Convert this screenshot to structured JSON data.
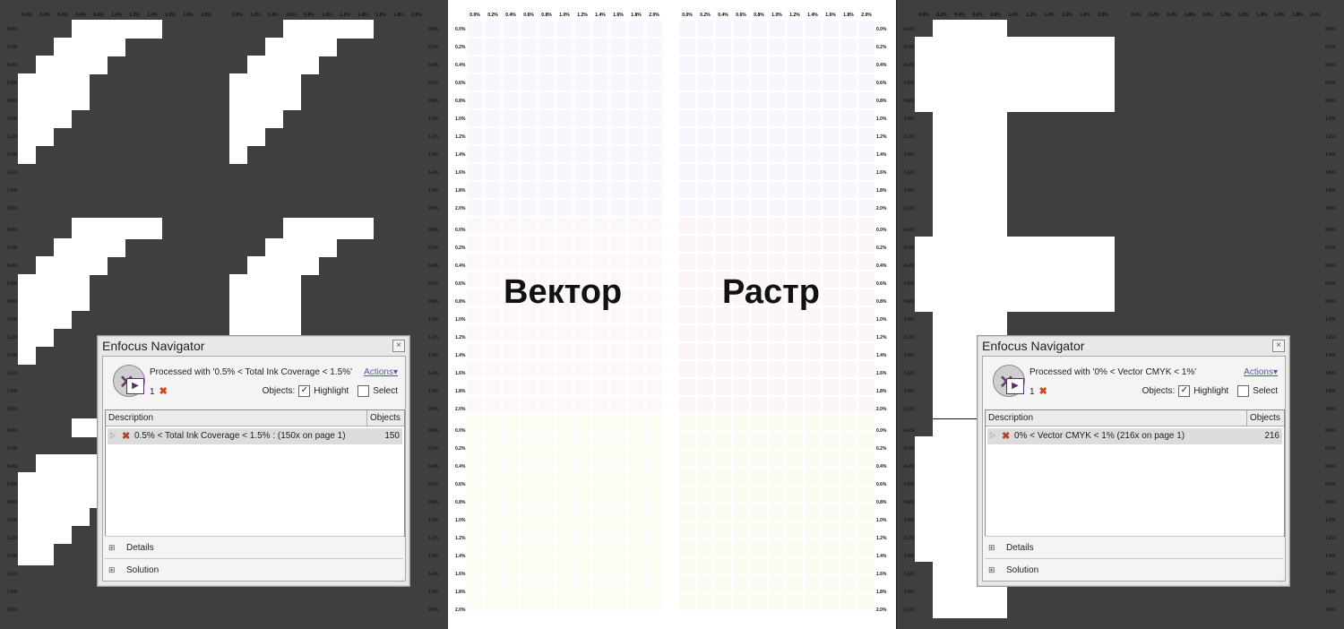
{
  "scale_top": [
    "0.0%",
    "0.2%",
    "0.4%",
    "0.6%",
    "0.8%",
    "1.0%",
    "1.2%",
    "1.4%",
    "1.6%",
    "1.8%",
    "2.0%"
  ],
  "scale_side": [
    "0.0%",
    "0.2%",
    "0.4%",
    "0.6%",
    "0.8%",
    "1.0%",
    "1.2%",
    "1.4%",
    "1.6%",
    "1.8%",
    "2.0%"
  ],
  "labels": {
    "vector": "Вектор",
    "raster": "Растр"
  },
  "navigator_left": {
    "title": "Enfocus Navigator",
    "processed": "Processed with '0.5% < Total Ink Coverage < 1.5%'",
    "actions": "Actions",
    "count": "1",
    "objects_label": "Objects:",
    "highlight": "Highlight",
    "select": "Select",
    "col_description": "Description",
    "col_objects": "Objects",
    "row_text": "0.5% < Total Ink Coverage < 1.5% :  (150x on page 1)",
    "row_count": "150",
    "details": "Details",
    "solution": "Solution"
  },
  "navigator_right": {
    "title": "Enfocus Navigator",
    "processed": "Processed with '0% < Vector CMYK < 1%'",
    "actions": "Actions",
    "count": "1",
    "objects_label": "Objects:",
    "highlight": "Highlight",
    "select": "Select",
    "col_description": "Description",
    "col_objects": "Objects",
    "row_text": "0% < Vector CMYK < 1% (216x on page 1)",
    "row_count": "216",
    "details": "Details",
    "solution": "Solution"
  },
  "colors": {
    "dark_bg": "#3f3f3f",
    "light_bg": "#ffffff",
    "action_link": "#4b57b5",
    "error_x": "#d0461a"
  }
}
